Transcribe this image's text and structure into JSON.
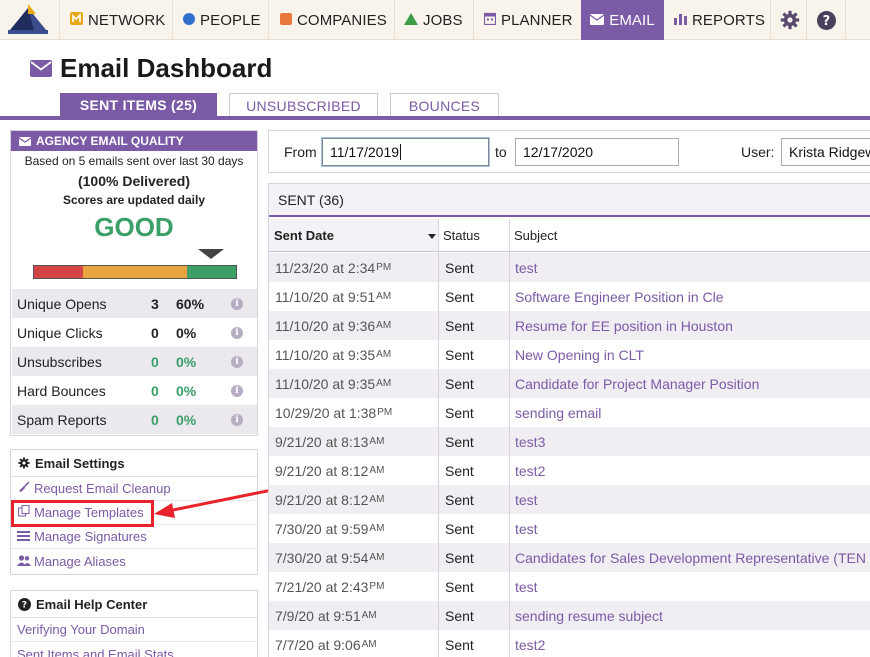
{
  "nav": {
    "items": [
      {
        "label": "NETWORK",
        "icon": "network-icon"
      },
      {
        "label": "PEOPLE",
        "icon": "people-dot-icon"
      },
      {
        "label": "COMPANIES",
        "icon": "companies-square-icon"
      },
      {
        "label": "JOBS",
        "icon": "jobs-triangle-icon"
      },
      {
        "label": "PLANNER",
        "icon": "planner-calendar-icon"
      },
      {
        "label": "EMAIL",
        "icon": "email-envelope-icon"
      },
      {
        "label": "REPORTS",
        "icon": "reports-bars-icon"
      }
    ],
    "colors": {
      "accent": "#7b5aa6",
      "network": "#e6a817",
      "people": "#2f6fce",
      "companies": "#e8793a",
      "jobs": "#3e9b46"
    }
  },
  "page": {
    "title": "Email Dashboard"
  },
  "tabs": [
    {
      "label": "SENT ITEMS (25)"
    },
    {
      "label": "UNSUBSCRIBED"
    },
    {
      "label": "BOUNCES"
    }
  ],
  "quality": {
    "header": "AGENCY EMAIL QUALITY",
    "based_on": "Based on 5 emails sent over last 30 days",
    "delivered": "(100% Delivered)",
    "updated": "Scores are updated daily",
    "rating": "GOOD",
    "stats": [
      {
        "label": "Unique Opens",
        "count": "3",
        "pct": "60%",
        "color": "#222222"
      },
      {
        "label": "Unique Clicks",
        "count": "0",
        "pct": "0%",
        "color": "#222222"
      },
      {
        "label": "Unsubscribes",
        "count": "0",
        "pct": "0%",
        "color": "#3aa067"
      },
      {
        "label": "Hard Bounces",
        "count": "0",
        "pct": "0%",
        "color": "#3aa067"
      },
      {
        "label": "Spam Reports",
        "count": "0",
        "pct": "0%",
        "color": "#3aa067"
      }
    ],
    "info_glyph": "i"
  },
  "settings": {
    "header": "Email Settings",
    "items": [
      {
        "label": "Request Email Cleanup",
        "icon": "broom-icon"
      },
      {
        "label": "Manage Templates",
        "icon": "templates-copy-icon"
      },
      {
        "label": "Manage Signatures",
        "icon": "signatures-lines-icon"
      },
      {
        "label": "Manage Aliases",
        "icon": "aliases-users-icon"
      }
    ]
  },
  "help": {
    "header": "Email Help Center",
    "items": [
      {
        "label": "Verifying Your Domain"
      },
      {
        "label": "Sent Items and Email Stats"
      }
    ]
  },
  "filter": {
    "from_label": "From",
    "from_value": "11/17/2019",
    "to_label": "to",
    "to_value": "12/17/2020",
    "user_label": "User:",
    "user_value": "Krista Ridgeway"
  },
  "sent": {
    "header": "SENT (36)",
    "columns": {
      "date": "Sent Date",
      "status": "Status",
      "subject": "Subject"
    },
    "rows": [
      {
        "date": "11/23/20 at 2:34",
        "ampm": "PM",
        "status": "Sent",
        "subject": "test"
      },
      {
        "date": "11/10/20 at 9:51",
        "ampm": "AM",
        "status": "Sent",
        "subject": "Software Engineer Position in Cle"
      },
      {
        "date": "11/10/20 at 9:36",
        "ampm": "AM",
        "status": "Sent",
        "subject": "Resume for EE position in Houston"
      },
      {
        "date": "11/10/20 at 9:35",
        "ampm": "AM",
        "status": "Sent",
        "subject": "New Opening in CLT"
      },
      {
        "date": "11/10/20 at 9:35",
        "ampm": "AM",
        "status": "Sent",
        "subject": "Candidate for Project Manager Position"
      },
      {
        "date": "10/29/20 at 1:38",
        "ampm": "PM",
        "status": "Sent",
        "subject": "sending email"
      },
      {
        "date": "9/21/20 at 8:13",
        "ampm": "AM",
        "status": "Sent",
        "subject": "test3"
      },
      {
        "date": "9/21/20 at 8:12",
        "ampm": "AM",
        "status": "Sent",
        "subject": "test2"
      },
      {
        "date": "9/21/20 at 8:12",
        "ampm": "AM",
        "status": "Sent",
        "subject": "test"
      },
      {
        "date": "7/30/20 at 9:59",
        "ampm": "AM",
        "status": "Sent",
        "subject": "test"
      },
      {
        "date": "7/30/20 at 9:54",
        "ampm": "AM",
        "status": "Sent",
        "subject": "Candidates for Sales Development Representative (TEN"
      },
      {
        "date": "7/21/20 at 2:43",
        "ampm": "PM",
        "status": "Sent",
        "subject": "test"
      },
      {
        "date": "7/9/20 at 9:51",
        "ampm": "AM",
        "status": "Sent",
        "subject": "sending resume subject"
      },
      {
        "date": "7/7/20 at 9:06",
        "ampm": "AM",
        "status": "Sent",
        "subject": "test2"
      }
    ]
  },
  "annotation": {
    "highlight_color": "#e8232b"
  }
}
